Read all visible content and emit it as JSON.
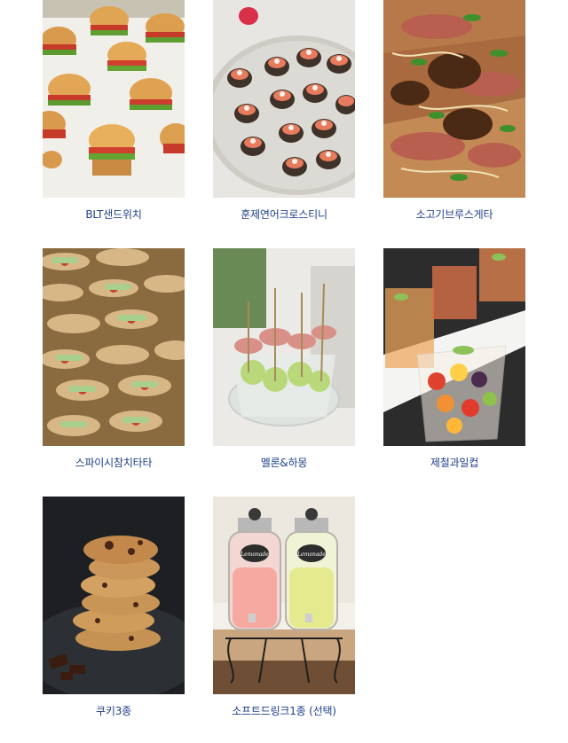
{
  "menu": {
    "items": [
      {
        "label": "BLT샌드위치",
        "image": "blt-sandwich-photo"
      },
      {
        "label": "훈제연어크로스티니",
        "image": "smoked-salmon-crostini-photo"
      },
      {
        "label": "소고기브루스게타",
        "image": "beef-bruschetta-photo"
      },
      {
        "label": "스파이시참치타타",
        "image": "spicy-tuna-tataki-photo"
      },
      {
        "label": "멜론&하몽",
        "image": "melon-jamon-photo"
      },
      {
        "label": "제철과일컵",
        "image": "seasonal-fruit-cup-photo"
      },
      {
        "label": "쿠키3종",
        "image": "three-cookies-photo"
      },
      {
        "label": "소프트드링크1종 (선택)",
        "image": "soft-drink-dispensers-photo"
      }
    ],
    "dispenser_labels": [
      "Lemonade",
      "Lemonade"
    ]
  }
}
